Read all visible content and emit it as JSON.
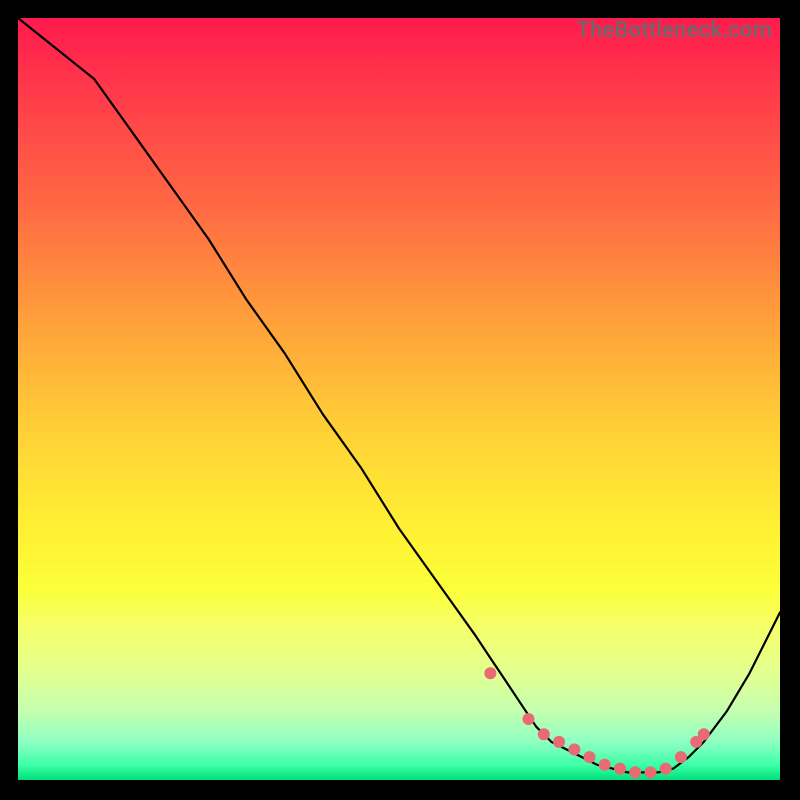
{
  "attribution": "TheBottleneck.com",
  "colors": {
    "marker_fill": "#e86a72",
    "line_stroke": "#000000"
  },
  "chart_data": {
    "type": "line",
    "title": "",
    "xlabel": "",
    "ylabel": "",
    "xlim": [
      0,
      100
    ],
    "ylim": [
      0,
      100
    ],
    "series": [
      {
        "name": "curve",
        "x": [
          0,
          5,
          10,
          15,
          20,
          25,
          30,
          35,
          40,
          45,
          50,
          55,
          60,
          62,
          64,
          66,
          68,
          70,
          72,
          74,
          76,
          78,
          80,
          82,
          84,
          86,
          88,
          90,
          93,
          96,
          100
        ],
        "y": [
          100,
          96,
          92,
          85,
          78,
          71,
          63,
          56,
          48,
          41,
          33,
          26,
          19,
          16,
          13,
          10,
          7,
          5,
          4,
          3,
          2,
          1.5,
          1,
          1,
          1,
          1.5,
          3,
          5,
          9,
          14,
          22
        ]
      }
    ],
    "markers": {
      "name": "highlight-points",
      "x": [
        62,
        67,
        69,
        71,
        73,
        75,
        77,
        79,
        81,
        83,
        85,
        87,
        89,
        90
      ],
      "y": [
        14,
        8,
        6,
        5,
        4,
        3,
        2,
        1.5,
        1,
        1,
        1.5,
        3,
        5,
        6
      ]
    }
  }
}
